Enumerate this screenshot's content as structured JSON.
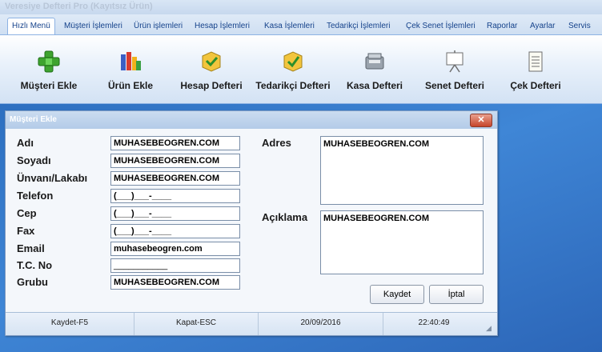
{
  "app": {
    "title": "Veresiye Defteri Pro (Kayıtsız Ürün)"
  },
  "ribbon": {
    "tabs": [
      "Hızlı Menü",
      "Müşteri İşlemleri",
      "Ürün işlemleri",
      "Hesap İşlemleri",
      "Kasa İşlemleri",
      "Tedarikçi İşlemleri",
      "Çek Senet İşlemleri",
      "Raporlar",
      "Ayarlar",
      "Servis"
    ],
    "buttons": [
      "Müşteri Ekle",
      "Ürün Ekle",
      "Hesap Defteri",
      "Tedarikçi Defteri",
      "Kasa Defteri",
      "Senet Defteri",
      "Çek Defteri"
    ]
  },
  "dialog": {
    "title": "Müşteri Ekle",
    "close_glyph": "✕",
    "labels": {
      "adi": "Adı",
      "soyadi": "Soyadı",
      "unvan": "Ünvanı/Lakabı",
      "telefon": "Telefon",
      "cep": "Cep",
      "fax": "Fax",
      "email": "Email",
      "tc": "T.C. No",
      "grubu": "Grubu",
      "adres": "Adres",
      "aciklama": "Açıklama"
    },
    "values": {
      "adi": "MUHASEBEOGREN.COM",
      "soyadi": "MUHASEBEOGREN.COM",
      "unvan": "MUHASEBEOGREN.COM",
      "telefon": "(___)___-____",
      "cep": "(___)___-____",
      "fax": "(___)___-____",
      "email": "muhasebeogren.com",
      "tc": "___________",
      "grubu": "MUHASEBEOGREN.COM",
      "adres": "MUHASEBEOGREN.COM",
      "aciklama": "MUHASEBEOGREN.COM"
    },
    "buttons": {
      "save": "Kaydet",
      "cancel": "İptal"
    },
    "status": {
      "save_hint": "Kaydet-F5",
      "close_hint": "Kapat-ESC",
      "date": "20/09/2016",
      "time": "22:40:49"
    }
  }
}
